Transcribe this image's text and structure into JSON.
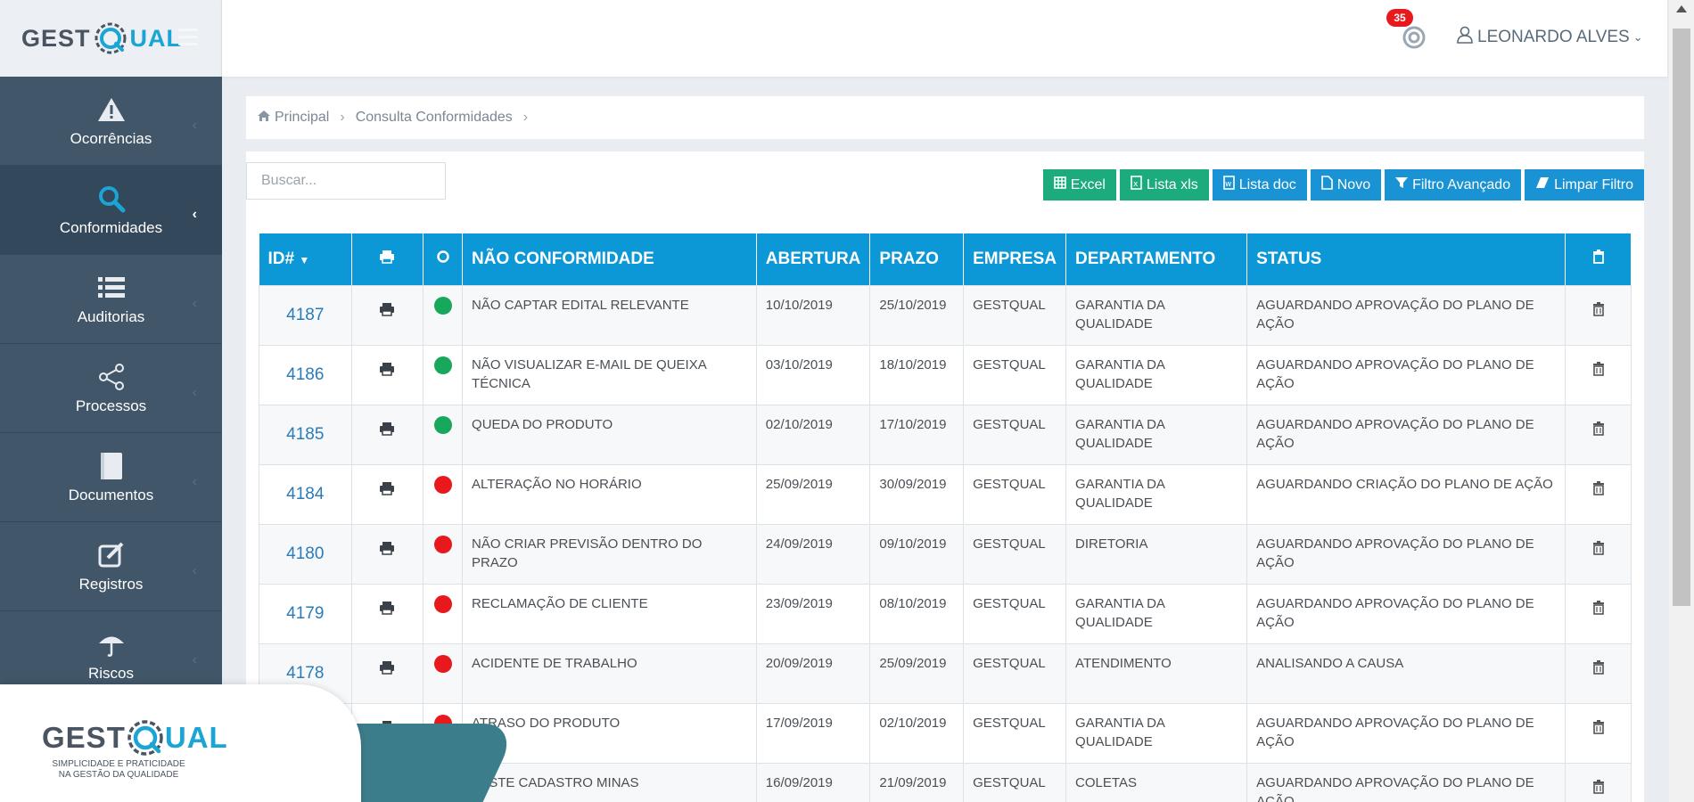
{
  "brand": {
    "left": "GEST",
    "right": "UAL",
    "q": "Q"
  },
  "sidebar": {
    "items": [
      {
        "label": "Ocorrências",
        "icon": "warning-icon"
      },
      {
        "label": "Conformidades",
        "icon": "search-icon",
        "active": true
      },
      {
        "label": "Auditorias",
        "icon": "list-icon"
      },
      {
        "label": "Processos",
        "icon": "share-icon"
      },
      {
        "label": "Documentos",
        "icon": "book-icon"
      },
      {
        "label": "Registros",
        "icon": "edit-icon"
      },
      {
        "label": "Riscos",
        "icon": "umbrella-icon"
      }
    ]
  },
  "header": {
    "notifications": "35",
    "user": "LEONARDO ALVES"
  },
  "breadcrumb": {
    "home": "Principal",
    "current": "Consulta Conformidades"
  },
  "search": {
    "placeholder": "Buscar..."
  },
  "toolbar": {
    "excel": "Excel",
    "lista_xls": "Lista xls",
    "lista_doc": "Lista doc",
    "novo": "Novo",
    "filtro": "Filtro Avançado",
    "limpar": "Limpar Filtro"
  },
  "table": {
    "headers": {
      "id": "ID#",
      "nc": "NÃO CONFORMIDADE",
      "abertura": "ABERTURA",
      "prazo": "PRAZO",
      "empresa": "EMPRESA",
      "departamento": "DEPARTAMENTO",
      "status": "STATUS"
    },
    "rows": [
      {
        "id": "4187",
        "dot": "green",
        "nc": "Não captar edital relevante",
        "abertura": "10/10/2019",
        "prazo": "25/10/2019",
        "empresa": "GESTQUAL",
        "departamento": "Garantia da Qualidade",
        "status": "Aguardando aprovação do plano de ação"
      },
      {
        "id": "4186",
        "dot": "green",
        "nc": "Não visualizar e-mail de queixa técnica",
        "abertura": "03/10/2019",
        "prazo": "18/10/2019",
        "empresa": "GESTQUAL",
        "departamento": "Garantia da Qualidade",
        "status": "Aguardando aprovação do plano de ação"
      },
      {
        "id": "4185",
        "dot": "green",
        "nc": "Queda do produto",
        "abertura": "02/10/2019",
        "prazo": "17/10/2019",
        "empresa": "GESTQUAL",
        "departamento": "Garantia da Qualidade",
        "status": "Aguardando aprovação do plano de ação"
      },
      {
        "id": "4184",
        "dot": "red",
        "nc": "Alteração no horário",
        "abertura": "25/09/2019",
        "prazo": "30/09/2019",
        "empresa": "GESTQUAL",
        "departamento": "Garantia da Qualidade",
        "status": "Aguardando criação do plano de ação"
      },
      {
        "id": "4180",
        "dot": "red",
        "nc": "Não criar previsão dentro do prazo",
        "abertura": "24/09/2019",
        "prazo": "09/10/2019",
        "empresa": "GESTQUAL",
        "departamento": "Diretoria",
        "status": "Aguardando aprovação do plano de ação"
      },
      {
        "id": "4179",
        "dot": "red",
        "nc": "Reclamação de cliente",
        "abertura": "23/09/2019",
        "prazo": "08/10/2019",
        "empresa": "GESTQUAL",
        "departamento": "Garantia da Qualidade",
        "status": "Aguardando aprovação do plano de ação"
      },
      {
        "id": "4178",
        "dot": "red",
        "nc": "Acidente de trabalho",
        "abertura": "20/09/2019",
        "prazo": "25/09/2019",
        "empresa": "GESTQUAL",
        "departamento": "Atendimento",
        "status": "Analisando a causa"
      },
      {
        "id": "",
        "dot": "red",
        "nc": "Atraso do produto",
        "abertura": "17/09/2019",
        "prazo": "02/10/2019",
        "empresa": "GESTQUAL",
        "departamento": "Garantia da Qualidade",
        "status": "Aguardando aprovação do plano de ação"
      },
      {
        "id": "",
        "dot": "",
        "nc": "Teste cadastro minas",
        "abertura": "16/09/2019",
        "prazo": "21/09/2019",
        "empresa": "GESTQUAL",
        "departamento": "Coletas",
        "status": "Aguardando aprovação do plano de ação"
      }
    ]
  },
  "overlay": {
    "logo_left": "GEST",
    "logo_right": "UAL",
    "tagline1": "SIMPLICIDADE E PRATICIDADE",
    "tagline2": "NA GESTÃO DA QUALIDADE"
  },
  "colors": {
    "sidebar": "#2a3f54",
    "table_header": "#0c97d7",
    "green_button": "#1bab7c",
    "blue_button": "#1993d3",
    "status_green": "#18a85c",
    "status_red": "#e8191c"
  }
}
